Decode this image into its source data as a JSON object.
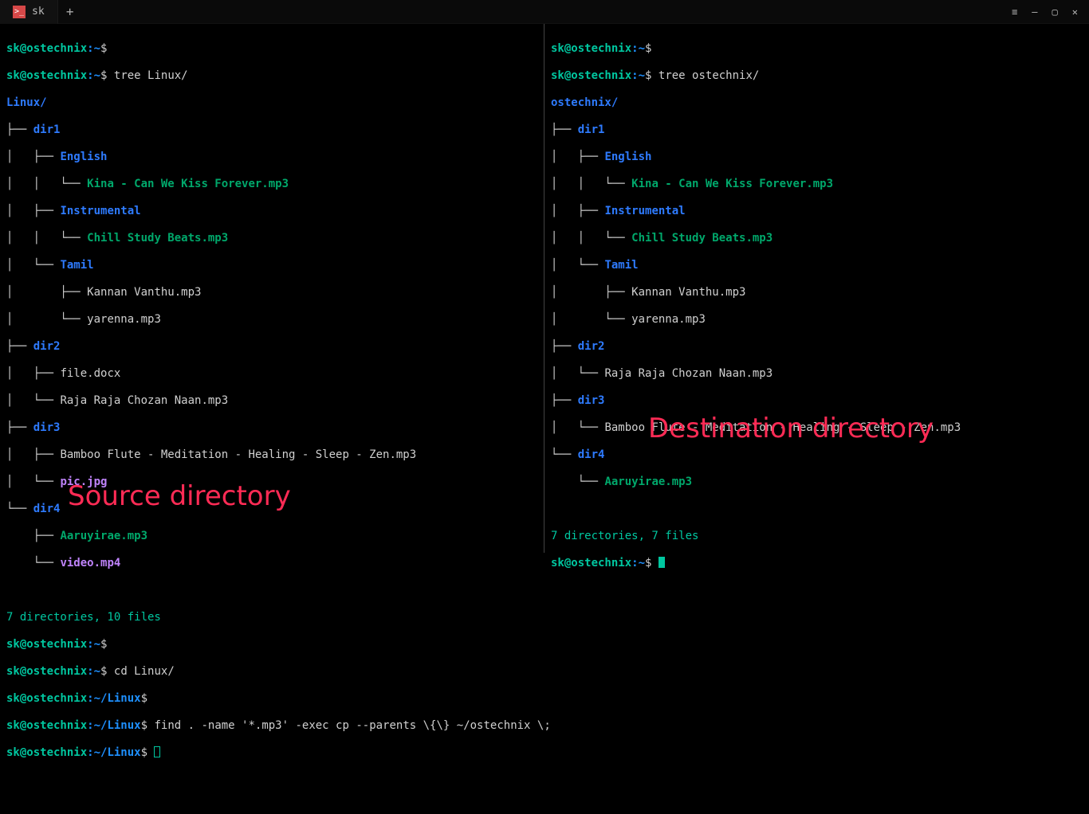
{
  "titlebar": {
    "tab_icon_text": ">_",
    "tab_label": "sk",
    "newtab_glyph": "+",
    "menu_glyph": "≡",
    "min_glyph": "—",
    "max_glyph": "▢",
    "close_glyph": "✕"
  },
  "prompt": {
    "userhost": "sk@ostechnix",
    "path_home": ":~",
    "path_linux": ":~/Linux",
    "dollar": "$"
  },
  "left": {
    "cmd_tree": "tree Linux/",
    "root": "Linux/",
    "dirs": {
      "dir1": "dir1",
      "english": "English",
      "instrumental": "Instrumental",
      "tamil": "Tamil",
      "dir2": "dir2",
      "dir3": "dir3",
      "dir4": "dir4"
    },
    "files": {
      "kina": "Kina - Can We Kiss Forever.mp3",
      "chill": "Chill Study Beats.mp3",
      "kannan": "Kannan Vanthu.mp3",
      "yarenna": "yarenna.mp3",
      "filedocx": "file.docx",
      "raja": "Raja Raja Chozan Naan.mp3",
      "bamboo": "Bamboo Flute - Meditation - Healing - Sleep - Zen.mp3",
      "pic": "pic.jpg",
      "aaruyirae": "Aaruyirae.mp3",
      "video": "video.mp4"
    },
    "summary": "7 directories, 10 files",
    "cmd_cd": "cd Linux/",
    "cmd_find": "find . -name '*.mp3' -exec cp --parents \\{\\} ~/ostechnix \\;",
    "overlay": "Source directory"
  },
  "right": {
    "cmd_tree": "tree ostechnix/",
    "root": "ostechnix/",
    "dirs": {
      "dir1": "dir1",
      "english": "English",
      "instrumental": "Instrumental",
      "tamil": "Tamil",
      "dir2": "dir2",
      "dir3": "dir3",
      "dir4": "dir4"
    },
    "files": {
      "kina": "Kina - Can We Kiss Forever.mp3",
      "chill": "Chill Study Beats.mp3",
      "kannan": "Kannan Vanthu.mp3",
      "yarenna": "yarenna.mp3",
      "raja": "Raja Raja Chozan Naan.mp3",
      "bamboo": "Bamboo Flute - Meditation - Healing - Sleep - Zen.mp3",
      "aaruyirae": "Aaruyirae.mp3"
    },
    "summary": "7 directories, 7 files",
    "overlay": "Destination directory"
  },
  "tree_glyph": {
    "mid": "├── ",
    "last": "└── ",
    "pipe": "│   ",
    "sp": "    "
  }
}
